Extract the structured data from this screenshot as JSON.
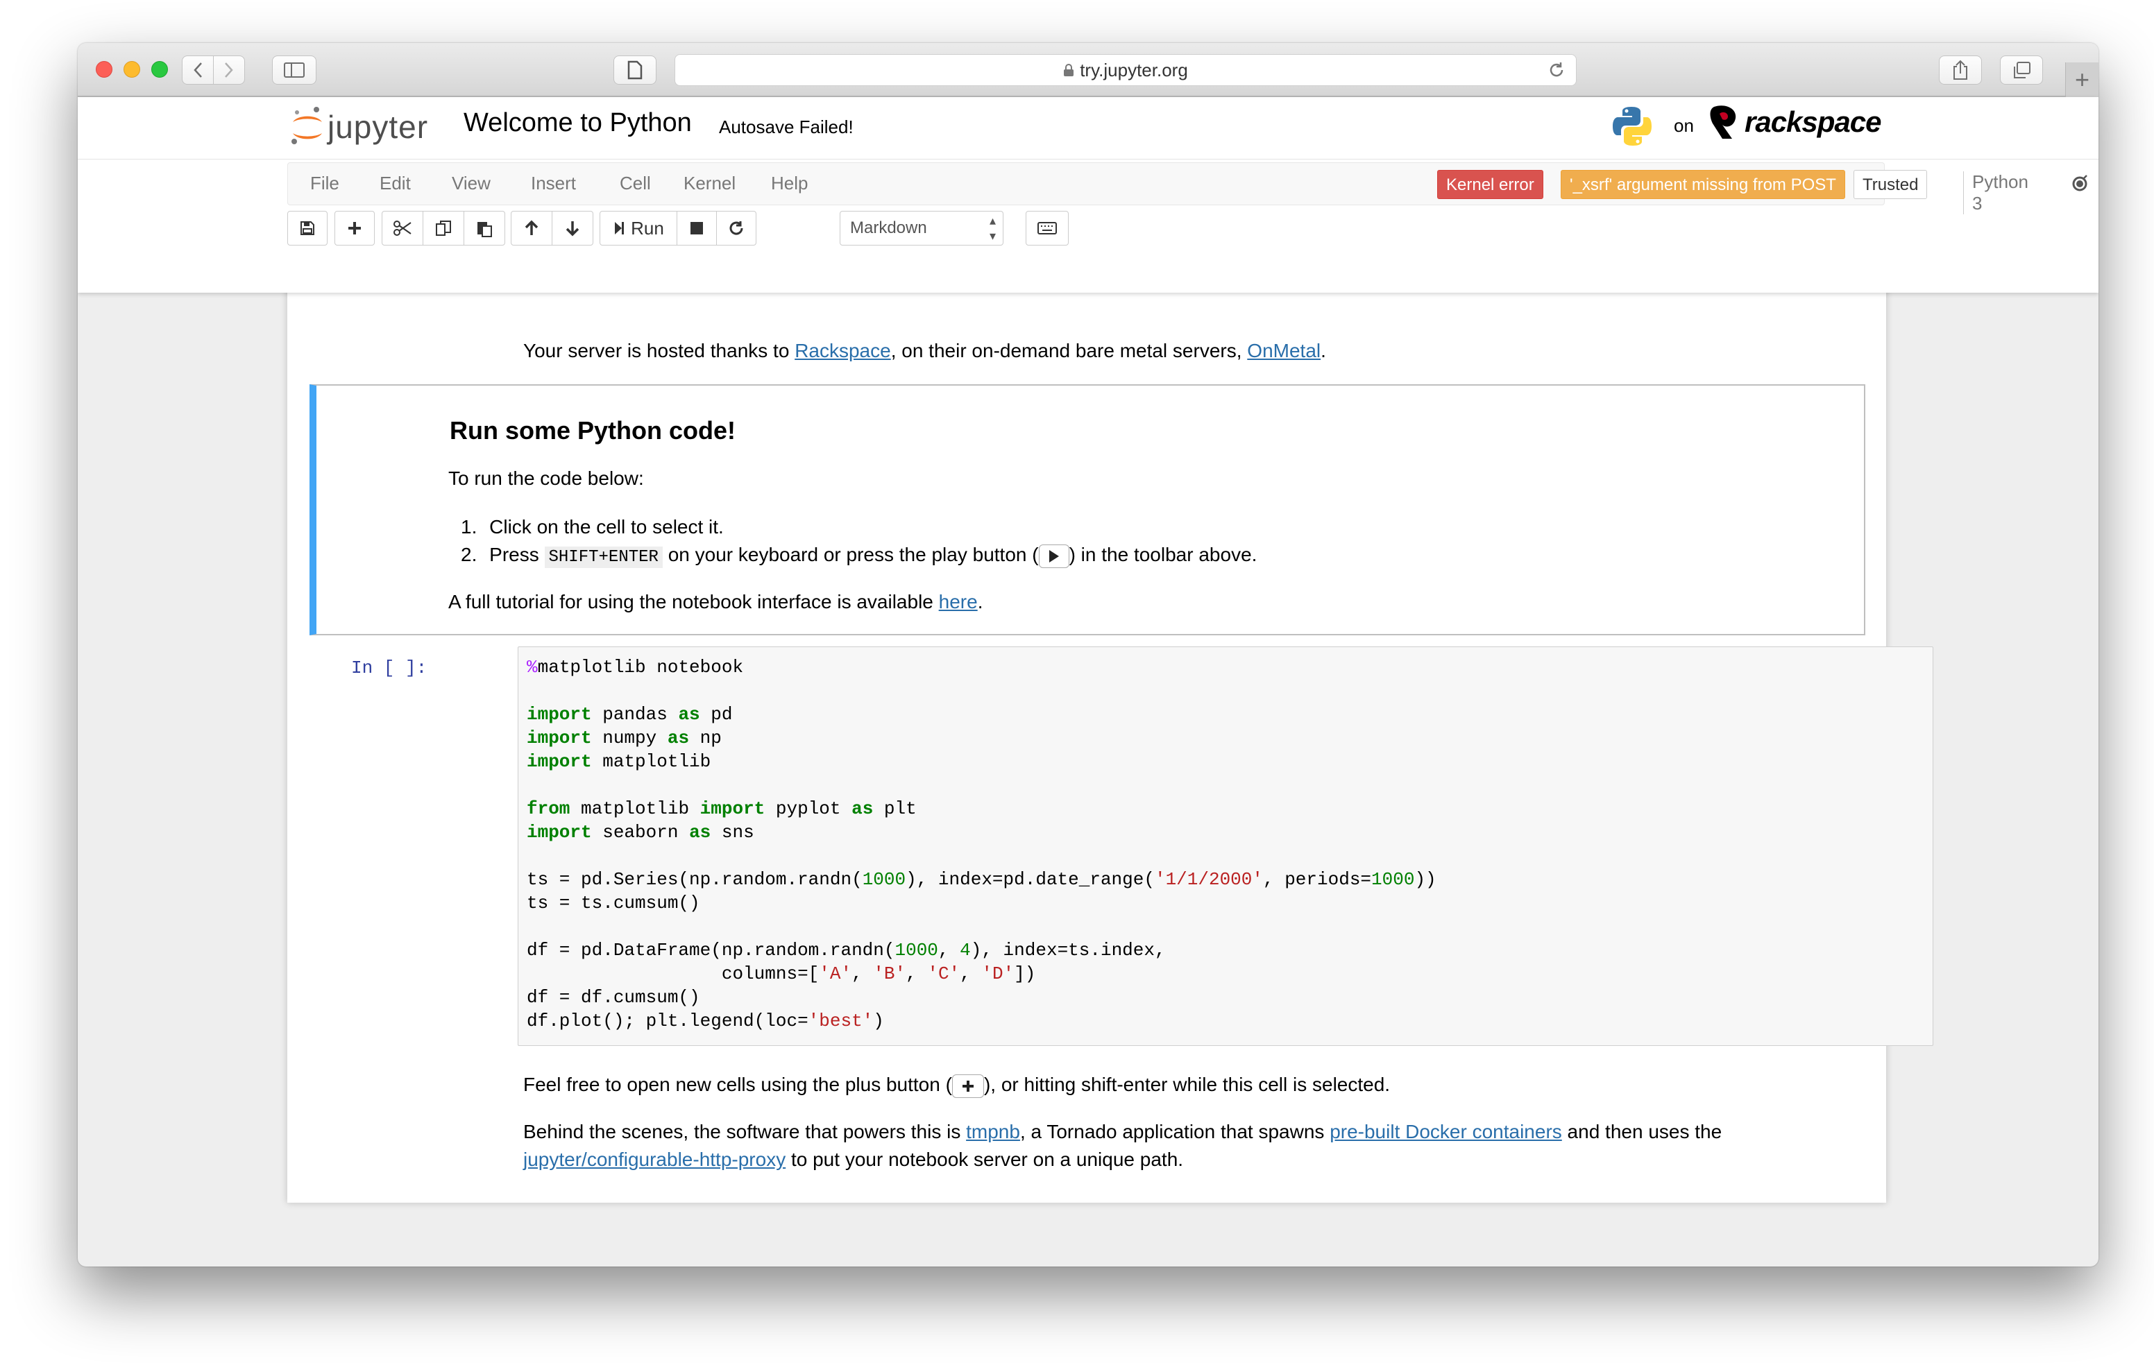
{
  "browser": {
    "url": "try.jupyter.org"
  },
  "jupyter": {
    "logo_text": "jupyter",
    "notebook_title": "Welcome to Python",
    "autosave_status": "Autosave Failed!",
    "on_text": "on",
    "sponsor_text": "rackspace",
    "menu": [
      "File",
      "Edit",
      "View",
      "Insert",
      "Cell",
      "Kernel",
      "Help"
    ],
    "kernel_error": "Kernel error",
    "xsrf_warning": "'_xsrf' argument missing from POST",
    "trusted": "Trusted",
    "kernel_name": "Python 3",
    "toolbar": {
      "run_label": "Run",
      "cell_type": "Markdown"
    }
  },
  "notebook": {
    "hosted": {
      "before": "Your server is hosted thanks to ",
      "link1": "Rackspace",
      "middle": ", on their on-demand bare metal servers, ",
      "link2": "OnMetal",
      "after": "."
    },
    "md_cell": {
      "heading": "Run some Python code!",
      "intro": "To run the code below:",
      "step1_num": "1.",
      "step1": "Click on the cell to select it.",
      "step2_num": "2.",
      "step2_before": "Press ",
      "step2_kbd": "SHIFT+ENTER",
      "step2_middle": " on your keyboard or press the play button (",
      "step2_after": ") in the toolbar above.",
      "tutorial_before": "A full tutorial for using the notebook interface is available ",
      "tutorial_link": "here",
      "tutorial_after": "."
    },
    "code_prompt": "In [ ]:",
    "code_lines": [
      [
        {
          "t": "%",
          "c": "mag"
        },
        {
          "t": "matplotlib notebook",
          "c": ""
        }
      ],
      [],
      [
        {
          "t": "import",
          "c": "kw"
        },
        {
          "t": " pandas ",
          "c": ""
        },
        {
          "t": "as",
          "c": "kw"
        },
        {
          "t": " pd",
          "c": ""
        }
      ],
      [
        {
          "t": "import",
          "c": "kw"
        },
        {
          "t": " numpy ",
          "c": ""
        },
        {
          "t": "as",
          "c": "kw"
        },
        {
          "t": " np",
          "c": ""
        }
      ],
      [
        {
          "t": "import",
          "c": "kw"
        },
        {
          "t": " matplotlib",
          "c": ""
        }
      ],
      [],
      [
        {
          "t": "from",
          "c": "kw"
        },
        {
          "t": " matplotlib ",
          "c": ""
        },
        {
          "t": "import",
          "c": "kw"
        },
        {
          "t": " pyplot ",
          "c": ""
        },
        {
          "t": "as",
          "c": "kw"
        },
        {
          "t": " plt",
          "c": ""
        }
      ],
      [
        {
          "t": "import",
          "c": "kw"
        },
        {
          "t": " seaborn ",
          "c": ""
        },
        {
          "t": "as",
          "c": "kw"
        },
        {
          "t": " sns",
          "c": ""
        }
      ],
      [],
      [
        {
          "t": "ts = pd.Series(np.random.randn(",
          "c": ""
        },
        {
          "t": "1000",
          "c": "num"
        },
        {
          "t": "), index=pd.date_range(",
          "c": ""
        },
        {
          "t": "'1/1/2000'",
          "c": "str"
        },
        {
          "t": ", periods=",
          "c": ""
        },
        {
          "t": "1000",
          "c": "num"
        },
        {
          "t": "))",
          "c": ""
        }
      ],
      [
        {
          "t": "ts = ts.cumsum()",
          "c": ""
        }
      ],
      [],
      [
        {
          "t": "df = pd.DataFrame(np.random.randn(",
          "c": ""
        },
        {
          "t": "1000",
          "c": "num"
        },
        {
          "t": ", ",
          "c": ""
        },
        {
          "t": "4",
          "c": "num"
        },
        {
          "t": "), index=ts.index,",
          "c": ""
        }
      ],
      [
        {
          "t": "                  columns=[",
          "c": ""
        },
        {
          "t": "'A'",
          "c": "str"
        },
        {
          "t": ", ",
          "c": ""
        },
        {
          "t": "'B'",
          "c": "str"
        },
        {
          "t": ", ",
          "c": ""
        },
        {
          "t": "'C'",
          "c": "str"
        },
        {
          "t": ", ",
          "c": ""
        },
        {
          "t": "'D'",
          "c": "str"
        },
        {
          "t": "])",
          "c": ""
        }
      ],
      [
        {
          "t": "df = df.cumsum()",
          "c": ""
        }
      ],
      [
        {
          "t": "df.plot(); plt.legend(loc=",
          "c": ""
        },
        {
          "t": "'best'",
          "c": "str"
        },
        {
          "t": ")",
          "c": ""
        }
      ]
    ],
    "free_cells": {
      "before": "Feel free to open new cells using the plus button (",
      "after": "), or hitting shift-enter while this cell is selected."
    },
    "behind": {
      "t1": "Behind the scenes, the software that powers this is ",
      "l1": "tmpnb",
      "t2": ", a Tornado application that spawns ",
      "l2": "pre-built Docker containers",
      "t3": " and then uses the",
      "l3": "jupyter/configurable-http-proxy",
      "t4": " to put your notebook server on a unique path."
    }
  }
}
